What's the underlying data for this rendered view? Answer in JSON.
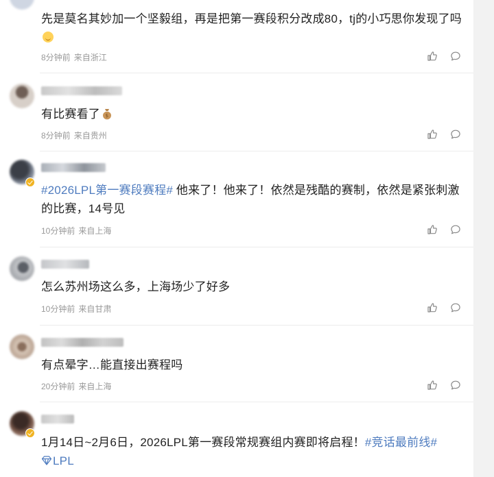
{
  "colors": {
    "topic_link": "#4f7cbf",
    "meta_text": "#999999",
    "body_text": "#222222",
    "verified": "#f0b323"
  },
  "icons": {
    "like": "thumbs-up-icon",
    "reply": "comment-bubble-icon",
    "verified": "verified-badge-icon"
  },
  "comments": [
    {
      "text": "先是莫名其妙加一个坚毅组，再是把第一赛段积分改成80，tj的小巧思你发现了吗",
      "time": "8分钟前",
      "location": "来自浙江"
    },
    {
      "text": "有比赛看了",
      "time": "8分钟前",
      "location": "来自贵州"
    },
    {
      "topic": "#2026LPL第一赛段赛程#",
      "text": " 他来了！他来了！依然是残酷的赛制，依然是紧张刺激的比赛，14号见",
      "time": "10分钟前",
      "location": "来自上海"
    },
    {
      "text": "怎么苏州场这么多，上海场少了好多",
      "time": "10分钟前",
      "location": "来自甘肃"
    },
    {
      "text": "有点晕字…能直接出赛程吗",
      "time": "20分钟前",
      "location": "来自上海"
    },
    {
      "text": "1月14日~2月6日，2026LPL第一赛段常规赛组内赛即将启程！",
      "topic": "#竞话最前线#",
      "tail": "LPL"
    }
  ]
}
